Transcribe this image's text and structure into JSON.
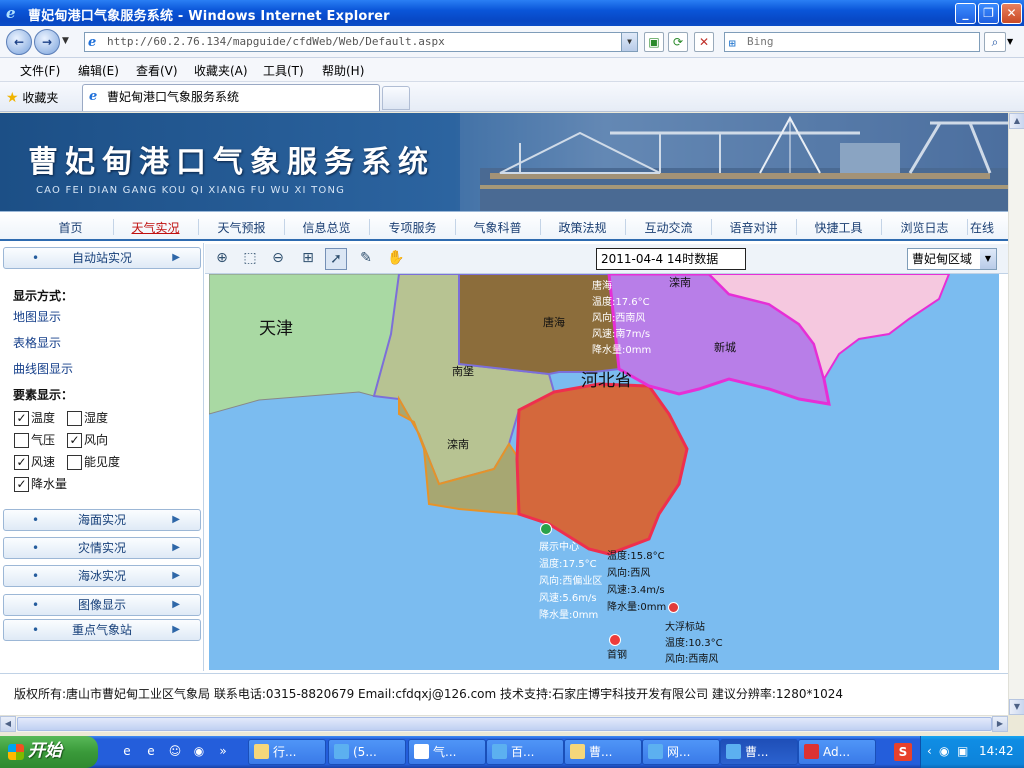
{
  "window": {
    "title": "曹妃甸港口气象服务系统 - Windows Internet Explorer",
    "minimize": "_",
    "restore": "❐",
    "close": "✕"
  },
  "address_bar": {
    "url": "http://60.2.76.134/mapguide/cfdWeb/Web/Default.aspx",
    "search_provider": "Bing"
  },
  "menu": [
    "文件(F)",
    "编辑(E)",
    "查看(V)",
    "收藏夹(A)",
    "工具(T)",
    "帮助(H)"
  ],
  "favorites": {
    "label": "收藏夹",
    "tab_title": "曹妃甸港口气象服务系统"
  },
  "banner": {
    "title": "曹妃甸港口气象服务系统",
    "subtitle": "CAO FEI DIAN GANG KOU QI XIANG FU WU XI TONG"
  },
  "nav": {
    "items": [
      "首页",
      "天气实况",
      "天气预报",
      "信息总览",
      "专项服务",
      "气象科普",
      "政策法规",
      "互动交流",
      "语音对讲",
      "快捷工具",
      "浏览日志",
      "在线"
    ],
    "active_index": 1
  },
  "left_panel": {
    "auto_station": "自动站实况",
    "display_mode_title": "显示方式：",
    "display_links": [
      "地图显示",
      "表格显示",
      "曲线图显示"
    ],
    "elements_title": "要素显示：",
    "checkboxes": [
      {
        "label": "温度",
        "checked": true
      },
      {
        "label": "湿度",
        "checked": false
      },
      {
        "label": "气压",
        "checked": false
      },
      {
        "label": "风向",
        "checked": true
      },
      {
        "label": "风速",
        "checked": true
      },
      {
        "label": "能见度",
        "checked": false
      },
      {
        "label": "降水量",
        "checked": true
      }
    ],
    "sections": [
      "海面实况",
      "灾情实况",
      "海冰实况",
      "图像显示",
      "重点气象站"
    ]
  },
  "map_toolbar": {
    "date_label": "2011-04-4 14时数据",
    "region": "曹妃甸区域"
  },
  "map": {
    "region_labels": {
      "tianjin": "天津",
      "hebei": "河北省",
      "tanghai": "唐海",
      "nanbao": "南堡",
      "luannan": "滦南",
      "xincheng": "新城",
      "luan_top": "滦南"
    },
    "stations": [
      {
        "name": "唐海",
        "temp": "温度:17.6°C",
        "wind_dir": "风向:西南风",
        "wind_speed": "风速:南7m/s",
        "rain": "降水量:0mm"
      },
      {
        "name": "展示中心",
        "temp": "温度:17.5°C",
        "wind_dir": "风向:西偏业区",
        "wind_speed": "风速:5.6m/s",
        "rain": "降水量:0mm"
      },
      {
        "name": "首钢",
        "temp": "温度:15.8°C",
        "wind_dir": "风向:西风",
        "wind_speed": "风速:3.4m/s",
        "rain": "降水量:0mm"
      },
      {
        "name": "大浮标站",
        "temp": "温度:10.3°C",
        "wind_dir": "风向:西南风",
        "wind_speed": "",
        "rain": ""
      }
    ],
    "colors": {
      "sea": "#7bbcf0",
      "tianjin": "#a9d9a3",
      "tanghai": "#8c6d3b",
      "nanbao": "#b7c392",
      "luannan": "#a7a772",
      "caofeidian": "#d4683c",
      "xincheng": "#b87ee8",
      "east": "#f5c8df"
    }
  },
  "footer": {
    "text": "版权所有:唐山市曹妃甸工业区气象局  联系电话:0315-8820679  Email:cfdqxj@126.com  技术支持:石家庄博宇科技开发有限公司 建议分辨率:1280*1024"
  },
  "taskbar": {
    "start": "开始",
    "buttons": [
      "行...",
      "(5...",
      "气...",
      "百...",
      "曹...",
      "网...",
      "曹...",
      "Ad..."
    ],
    "active_index": 6,
    "clock": "14:42"
  }
}
